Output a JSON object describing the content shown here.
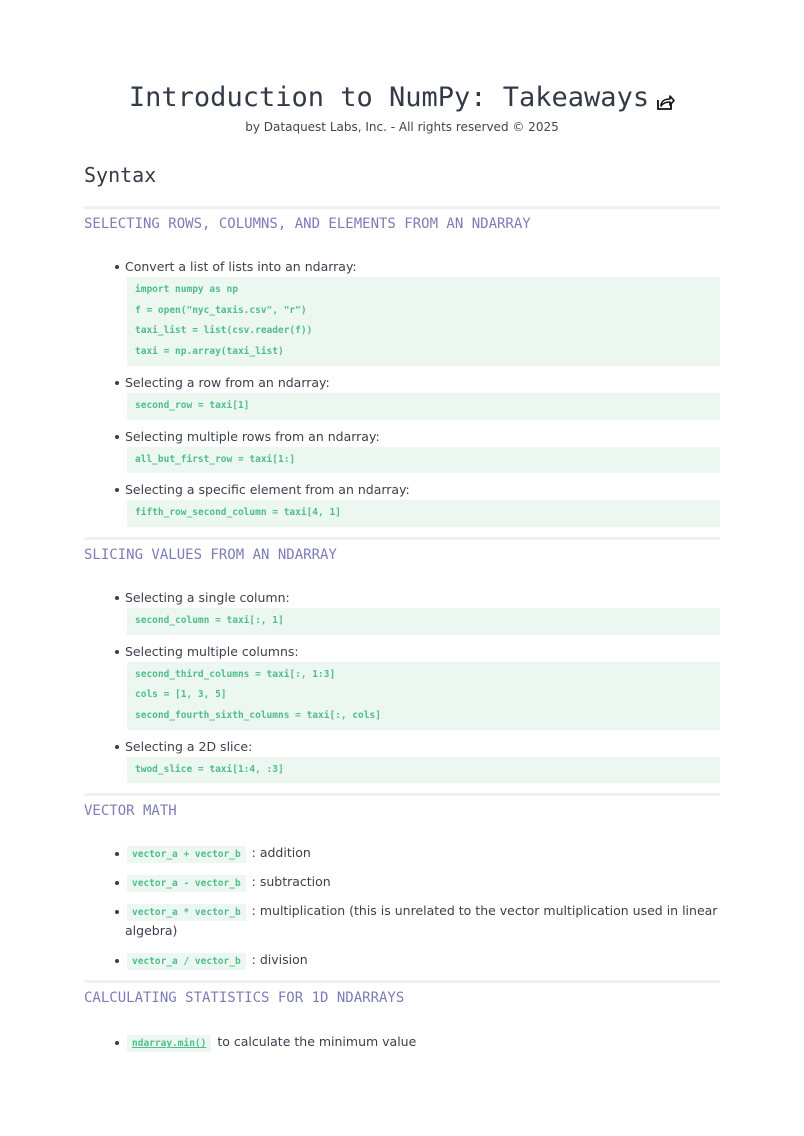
{
  "header": {
    "title": "Introduction to NumPy: Takeaways",
    "subtitle": "by Dataquest Labs, Inc. - All rights reserved © 2025",
    "share_icon": "share-icon"
  },
  "section_title": "Syntax",
  "sections": [
    {
      "heading": "SELECTING ROWS, COLUMNS, AND ELEMENTS FROM AN NDARRAY",
      "items": [
        {
          "text": "Convert a list of lists into an ndarray:",
          "code": [
            "import numpy as np",
            "f = open(\"nyc_taxis.csv\", \"r\")",
            "taxi_list = list(csv.reader(f))",
            "taxi = np.array(taxi_list)"
          ]
        },
        {
          "text": "Selecting a row from an ndarray:",
          "code": [
            "second_row = taxi[1]"
          ]
        },
        {
          "text": "Selecting multiple rows from an ndarray:",
          "code": [
            "all_but_first_row = taxi[1:]"
          ]
        },
        {
          "text": "Selecting a specific element from an ndarray:",
          "code": [
            "fifth_row_second_column = taxi[4, 1]"
          ]
        }
      ]
    },
    {
      "heading": "SLICING VALUES FROM AN NDARRAY",
      "items": [
        {
          "text": "Selecting a single column:",
          "code": [
            "second_column = taxi[:, 1]"
          ]
        },
        {
          "text": "Selecting multiple columns:",
          "code": [
            "second_third_columns = taxi[:, 1:3]",
            "cols = [1, 3, 5]",
            "second_fourth_sixth_columns = taxi[:, cols]"
          ]
        },
        {
          "text": "Selecting a 2D slice:",
          "code": [
            "twod_slice = taxi[1:4, :3]"
          ]
        }
      ]
    },
    {
      "heading": "VECTOR MATH",
      "items": [
        {
          "code": "vector_a + vector_b",
          "text": ": addition"
        },
        {
          "code": "vector_a - vector_b",
          "text": ": subtraction"
        },
        {
          "code": "vector_a * vector_b",
          "text": ": multiplication (this is unrelated to the vector multiplication used in linear algebra)"
        },
        {
          "code": "vector_a / vector_b",
          "text": ": division"
        }
      ]
    },
    {
      "heading": "CALCULATING STATISTICS FOR 1D NDARRAYS",
      "items": [
        {
          "code": "ndarray.min()",
          "text": " to calculate the minimum value"
        }
      ]
    }
  ]
}
